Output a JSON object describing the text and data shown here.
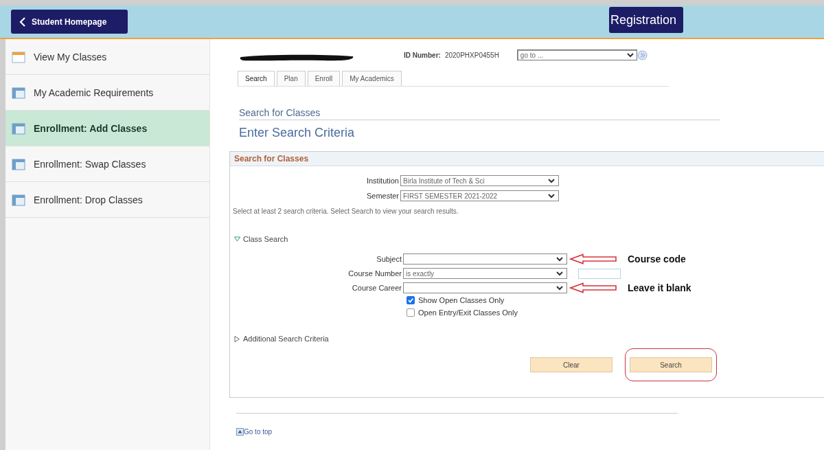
{
  "header": {
    "back_button": "Student Homepage",
    "title": "Registration"
  },
  "sidebar": {
    "items": [
      {
        "label": "View My Classes",
        "kind": "calendar",
        "selected": false
      },
      {
        "label": "My Academic Requirements",
        "kind": "page",
        "selected": false
      },
      {
        "label": "Enrollment:  Add Classes",
        "kind": "page",
        "selected": true
      },
      {
        "label": "Enrollment:  Swap Classes",
        "kind": "page",
        "selected": false
      },
      {
        "label": "Enrollment:  Drop Classes",
        "kind": "page",
        "selected": false
      }
    ]
  },
  "student": {
    "name_redacted": true,
    "id_label": "ID Number:",
    "id_value": "2020PHXP0455H",
    "goto": "go to ..."
  },
  "tabs": [
    {
      "label": "Search",
      "selected": true
    },
    {
      "label": "Plan",
      "selected": false
    },
    {
      "label": "Enroll",
      "selected": false
    },
    {
      "label": "My Academics",
      "selected": false
    }
  ],
  "breadcrumb": "Search for Classes",
  "page_title": "Enter Search Criteria",
  "panel": {
    "title": "Search for Classes",
    "fields": [
      {
        "label": "Institution",
        "value": "Birla Institute of Tech & Sci"
      },
      {
        "label": "Semester",
        "value": "FIRST SEMESTER 2021-2022"
      }
    ],
    "hint": "Select at least 2 search criteria. Select Search to view your search results.",
    "class_search": {
      "label": "Class Search",
      "expanded": true,
      "fields": [
        {
          "label": "Subject",
          "kind": "select",
          "annotation": "Course code"
        },
        {
          "label": "Course Number",
          "value": "is exactly",
          "kind": "select_with_input"
        },
        {
          "label": "Course Career",
          "kind": "select",
          "annotation": "Leave it blank"
        }
      ],
      "checkboxes": [
        {
          "label": "Show Open Classes Only",
          "checked": true
        },
        {
          "label": "Open Entry/Exit Classes Only",
          "checked": false
        }
      ]
    },
    "additional": {
      "label": "Additional Search Criteria",
      "expanded": false
    },
    "buttons": [
      {
        "label": "Clear",
        "circled": false
      },
      {
        "label": "Search",
        "circled": true
      }
    ]
  },
  "go_to_top": "Go to top"
}
